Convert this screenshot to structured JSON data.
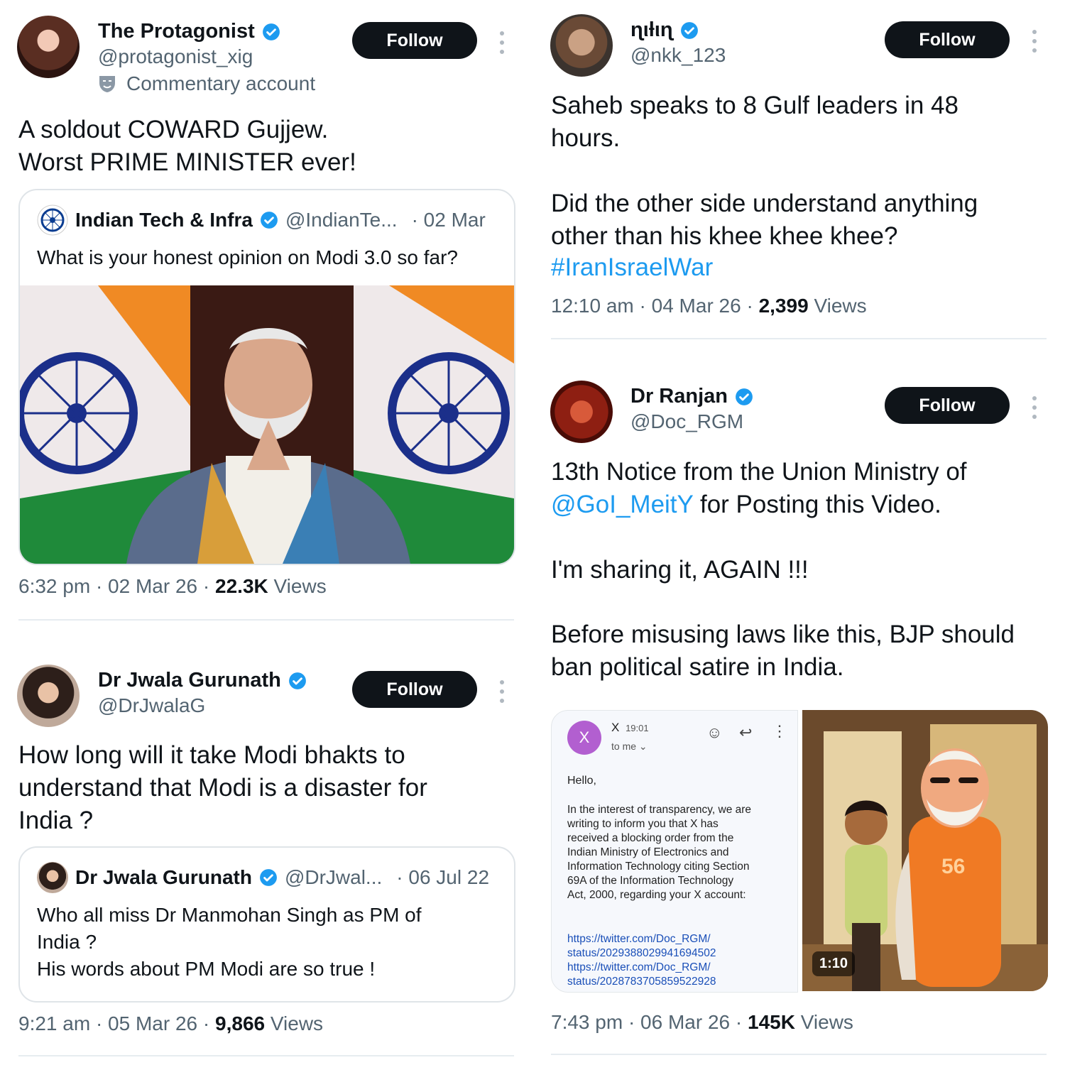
{
  "left_column": {
    "tweet1": {
      "author": "The Protagonist",
      "handle": "@protagonist_xig",
      "label": "Commentary account",
      "follow_label": "Follow",
      "text": "A soldout COWARD Gujjew.\nWorst PRIME MINISTER ever!",
      "quote": {
        "author": "Indian Tech & Infra",
        "handle": "@IndianTe...",
        "date": "· 02 Mar",
        "text": "What is your honest opinion on Modi 3.0 so far?"
      },
      "time": "6:32 pm · 02 Mar 26 · ",
      "views_count": "22.3K",
      "views_label": "Views"
    },
    "tweet2": {
      "author": "Dr Jwala Gurunath",
      "handle": "@DrJwalaG",
      "follow_label": "Follow",
      "text": "How long will it take Modi bhakts to\nunderstand that Modi is a disaster for\nIndia ?",
      "quote": {
        "author": "Dr Jwala Gurunath",
        "handle": "@DrJwal...",
        "date": "· 06 Jul 22",
        "text": "Who all miss Dr Manmohan Singh as PM of\nIndia ?\nHis words about PM Modi are so true !"
      },
      "time": "9:21 am · 05 Mar 26 · ",
      "views_count": "9,866",
      "views_label": "Views"
    }
  },
  "right_column": {
    "tweet3": {
      "author": "ɳιƚιɳ",
      "handle": "@nkk_123",
      "follow_label": "Follow",
      "text": "Saheb speaks to 8 Gulf leaders in 48\nhours.\n\nDid the other side understand anything\nother than his khee khee khee?",
      "hashtag": "#IranIsraelWar",
      "time": "12:10 am · 04 Mar 26 · ",
      "views_count": "2,399",
      "views_label": "Views"
    },
    "tweet4": {
      "author": "Dr Ranjan",
      "handle": "@Doc_RGM",
      "follow_label": "Follow",
      "text_a": "13th Notice from the Union Ministry of",
      "mention": "@GoI_MeitY",
      "text_b": " for Posting this Video.",
      "text_c": "I'm sharing it, AGAIN !!!",
      "text_d": "Before misusing laws like this, BJP should\nban political satire in India.",
      "email": {
        "avatar_letter": "X",
        "sender": "X",
        "time": "19:01",
        "to": "to me",
        "greeting": "Hello,",
        "body": "In the interest of transparency, we are\nwriting to inform you that X has\nreceived a blocking order from the\nIndian Ministry of Electronics and\nInformation Technology citing Section\n69A of the Information Technology\nAct, 2000, regarding your X account:",
        "links": "https://twitter.com/Doc_RGM/\nstatus/2029388029941694502\nhttps://twitter.com/Doc_RGM/\nstatus/2028783705859522928"
      },
      "video_duration": "1:10",
      "jacket_number": "56",
      "time": "7:43 pm · 06 Mar 26 · ",
      "views_count": "145K",
      "views_label": "Views"
    }
  }
}
